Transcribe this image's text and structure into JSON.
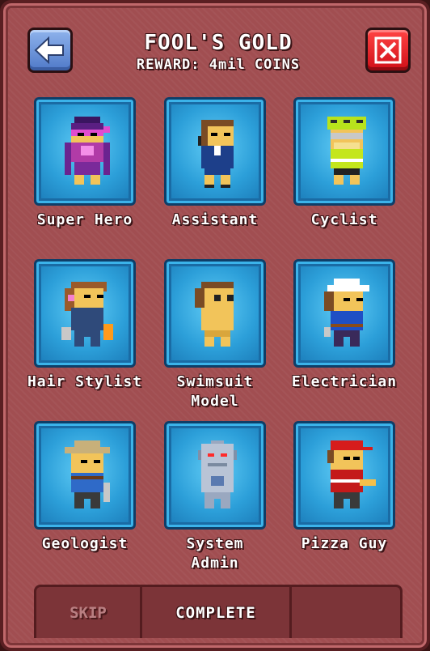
{
  "header": {
    "title": "FOOL'S GOLD",
    "subtitle": "REWARD: 4mil COINS"
  },
  "icons": {
    "back": "back-arrow-icon",
    "close": "close-x-icon"
  },
  "colors": {
    "panel": "#a14e51",
    "tile": "#2c9fd9",
    "back_button": "#6a92dc",
    "close_button": "#e8141f"
  },
  "characters": [
    {
      "label": "Super Hero"
    },
    {
      "label": "Assistant"
    },
    {
      "label": "Cyclist"
    },
    {
      "label": "Hair Stylist"
    },
    {
      "label": "Swimsuit\nModel"
    },
    {
      "label": "Electrician"
    },
    {
      "label": "Geologist"
    },
    {
      "label": "System\nAdmin"
    },
    {
      "label": "Pizza Guy"
    }
  ],
  "tabs": {
    "skip": "SKIP",
    "complete": "COMPLETE"
  }
}
